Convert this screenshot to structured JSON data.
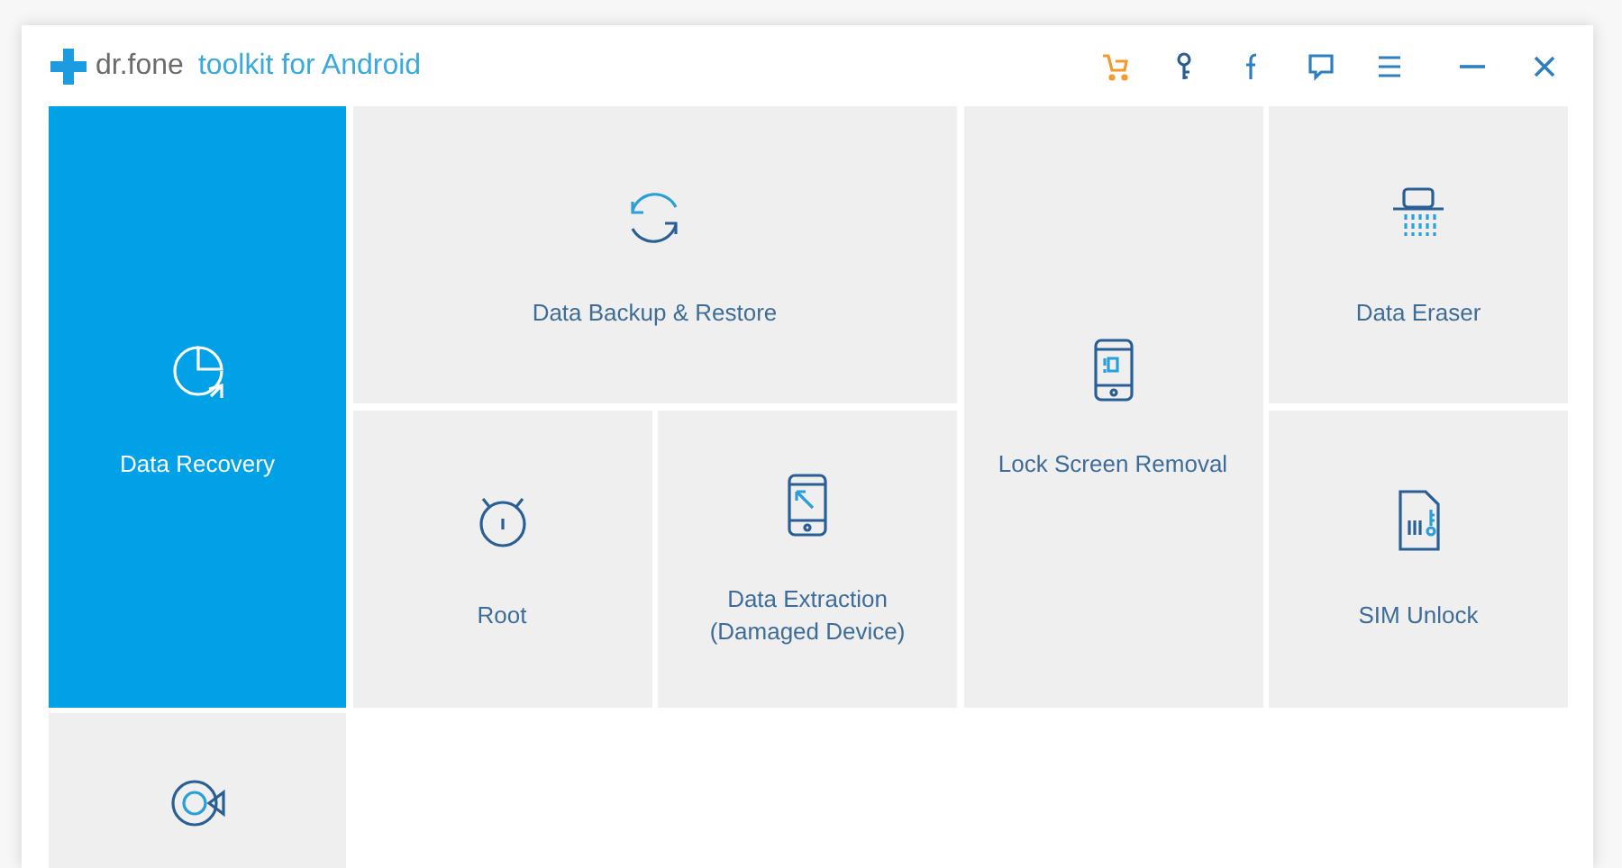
{
  "window": {
    "logo_name": "dr.fone",
    "product": "toolkit for Android"
  },
  "tiles": [
    {
      "label": "Data Recovery",
      "selected": true
    },
    {
      "label": "Data Backup & Restore",
      "selected": false
    },
    {
      "label": "Lock Screen Removal",
      "selected": false
    },
    {
      "label": "Data Eraser",
      "selected": false
    },
    {
      "label": "Root",
      "selected": false
    },
    {
      "label": "Data Extraction (Damaged Device)",
      "selected": false
    },
    {
      "label": "SIM Unlock",
      "selected": false
    },
    {
      "selected": false
    }
  ]
}
